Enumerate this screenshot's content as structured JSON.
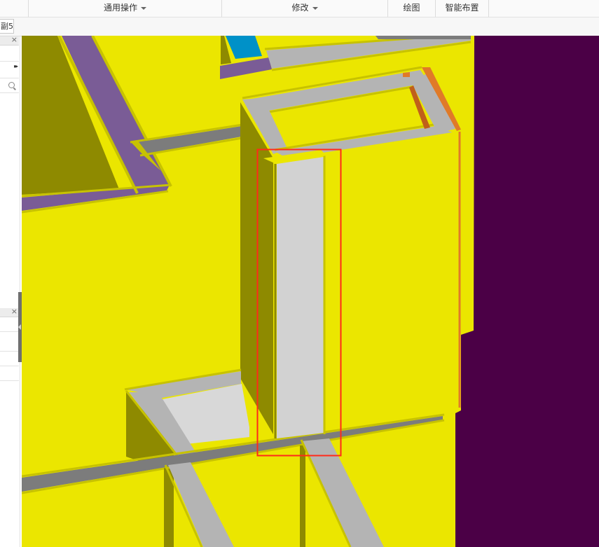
{
  "ribbon": {
    "groups": [
      {
        "label": "通用操作",
        "has_dropdown": true
      },
      {
        "label": "修改",
        "has_dropdown": true
      },
      {
        "label": "绘图",
        "has_dropdown": false
      },
      {
        "label": "智能布置",
        "has_dropdown": false
      }
    ]
  },
  "toolbar": {
    "mini_combo_text": "副5"
  },
  "left_panels": {
    "top_panel_close": "×",
    "bottom_panel_close": "×"
  },
  "viewport": {
    "scene": "3D model view",
    "colors": {
      "wall_yellow": "#ebe600",
      "wall_shade": "#8e8a00",
      "beam_grey": "#b4b4b4",
      "dark_background": "#4b0046",
      "purple_beam": "#7a5c96",
      "orange_edge": "#e07a28",
      "column_highlight": "#d2d2d2",
      "selection_box": "#ff2a1a"
    }
  }
}
